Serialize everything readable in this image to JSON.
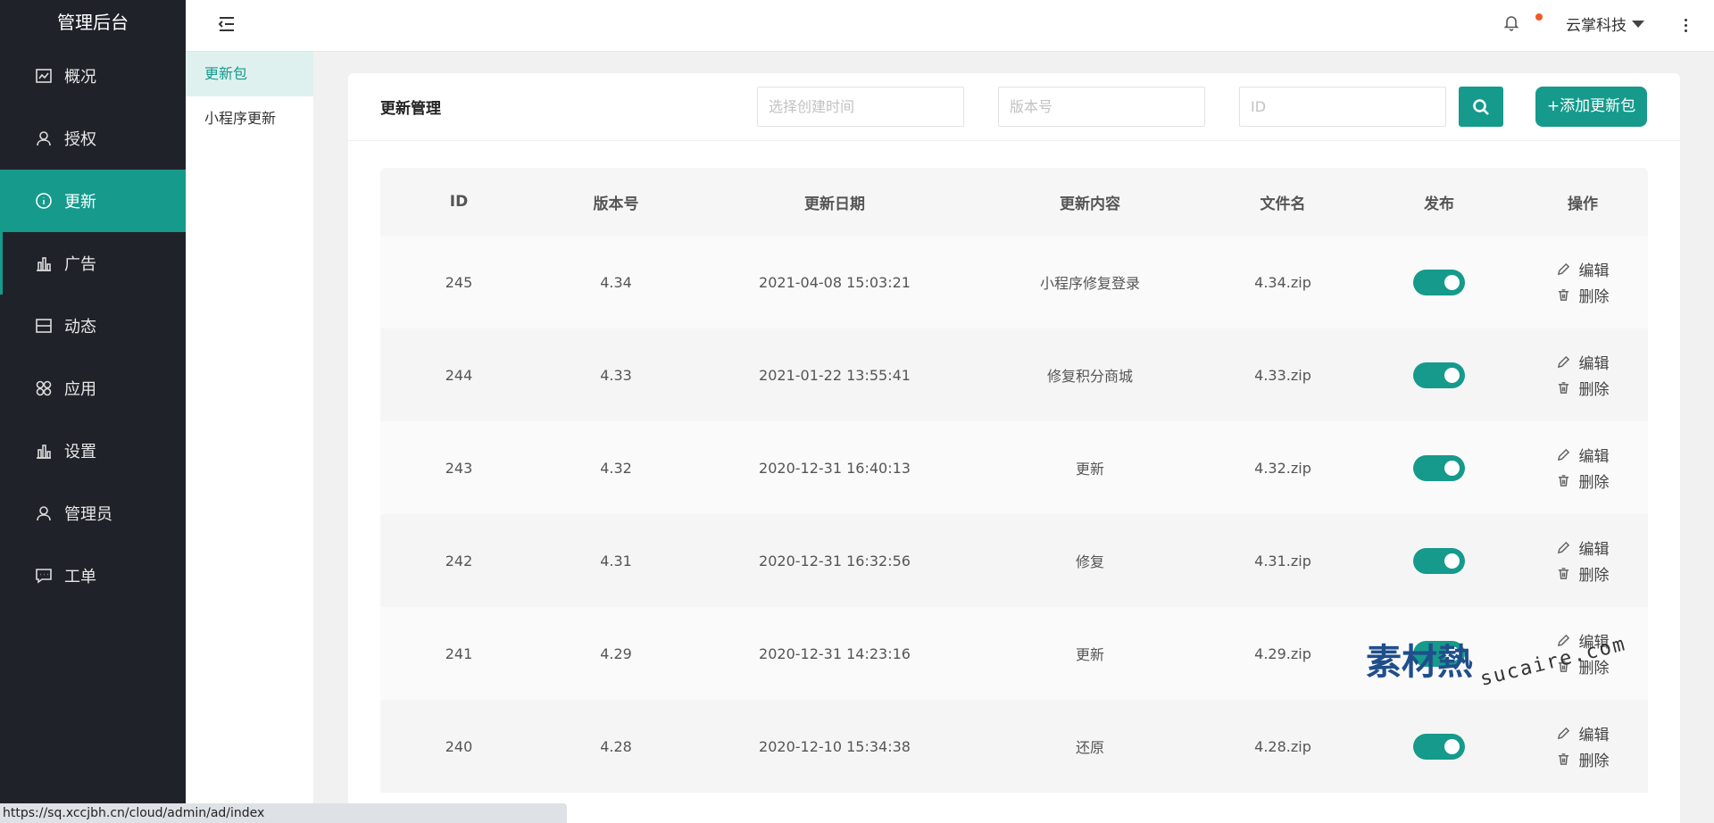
{
  "app": {
    "title": "管理后台"
  },
  "sidebar": {
    "items": [
      {
        "label": "概况",
        "icon": "dashboard-icon"
      },
      {
        "label": "授权",
        "icon": "user-icon"
      },
      {
        "label": "更新",
        "icon": "info-icon",
        "active": true
      },
      {
        "label": "广告",
        "icon": "bar-chart-icon"
      },
      {
        "label": "动态",
        "icon": "feed-icon"
      },
      {
        "label": "应用",
        "icon": "apps-icon"
      },
      {
        "label": "设置",
        "icon": "bar-chart-icon"
      },
      {
        "label": "管理员",
        "icon": "user-icon"
      },
      {
        "label": "工单",
        "icon": "message-icon"
      }
    ]
  },
  "subnav": {
    "items": [
      {
        "label": "更新包",
        "active": true
      },
      {
        "label": "小程序更新"
      }
    ]
  },
  "header": {
    "user_name": "云掌科技"
  },
  "card": {
    "title": "更新管理",
    "filters": {
      "date_placeholder": "选择创建时间",
      "version_placeholder": "版本号",
      "id_placeholder": "ID"
    },
    "add_label": "+添加更新包"
  },
  "table": {
    "columns": [
      "ID",
      "版本号",
      "更新日期",
      "更新内容",
      "文件名",
      "发布",
      "操作"
    ],
    "edit_label": "编辑",
    "delete_label": "删除",
    "rows": [
      {
        "id": "245",
        "version": "4.34",
        "date": "2021-04-08 15:03:21",
        "content": "小程序修复登录",
        "file": "4.34.zip",
        "published": true
      },
      {
        "id": "244",
        "version": "4.33",
        "date": "2021-01-22 13:55:41",
        "content": "修复积分商城",
        "file": "4.33.zip",
        "published": true
      },
      {
        "id": "243",
        "version": "4.32",
        "date": "2020-12-31 16:40:13",
        "content": "更新",
        "file": "4.32.zip",
        "published": true
      },
      {
        "id": "242",
        "version": "4.31",
        "date": "2020-12-31 16:32:56",
        "content": "修复",
        "file": "4.31.zip",
        "published": true
      },
      {
        "id": "241",
        "version": "4.29",
        "date": "2020-12-31 14:23:16",
        "content": "更新",
        "file": "4.29.zip",
        "published": true
      },
      {
        "id": "240",
        "version": "4.28",
        "date": "2020-12-10 15:34:38",
        "content": "还原",
        "file": "4.28.zip",
        "published": true
      }
    ]
  },
  "statusbar": {
    "url": "https://sq.xccjbh.cn/cloud/admin/ad/index"
  },
  "watermark": {
    "logo": "素材熱",
    "text": "sucaire.com"
  },
  "colors": {
    "accent": "#159a8c",
    "sidebar_bg": "#20222a",
    "notify_dot": "#f05a28"
  }
}
